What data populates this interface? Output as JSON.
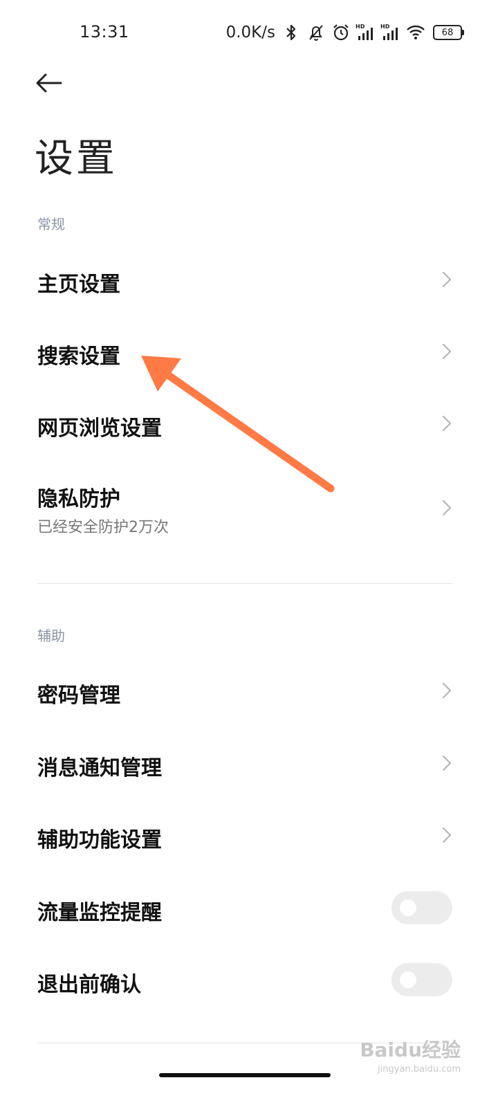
{
  "status_bar": {
    "time": "13:31",
    "net_speed": "0.0K/s",
    "battery": "68",
    "icons": [
      "bluetooth-icon",
      "mute-icon",
      "alarm-icon",
      "signal-hd-icon",
      "signal-hd-icon",
      "wifi-icon",
      "battery-icon"
    ]
  },
  "header": {
    "title": "设置"
  },
  "sections": {
    "general": {
      "label": "常规",
      "items": [
        {
          "label": "主页设置"
        },
        {
          "label": "搜索设置"
        },
        {
          "label": "网页浏览设置"
        },
        {
          "label": "隐私防护",
          "sub": "已经安全防护2万次"
        }
      ]
    },
    "assist": {
      "label": "辅助",
      "items": [
        {
          "label": "密码管理"
        },
        {
          "label": "消息通知管理"
        },
        {
          "label": "辅助功能设置"
        },
        {
          "label": "流量监控提醒",
          "toggle": false
        },
        {
          "label": "退出前确认",
          "toggle": false
        }
      ]
    }
  },
  "annotation": {
    "arrow_color": "#ff7a45"
  },
  "watermark": {
    "text": "Baidu经验",
    "sub": "jingyan.baidu.com"
  }
}
